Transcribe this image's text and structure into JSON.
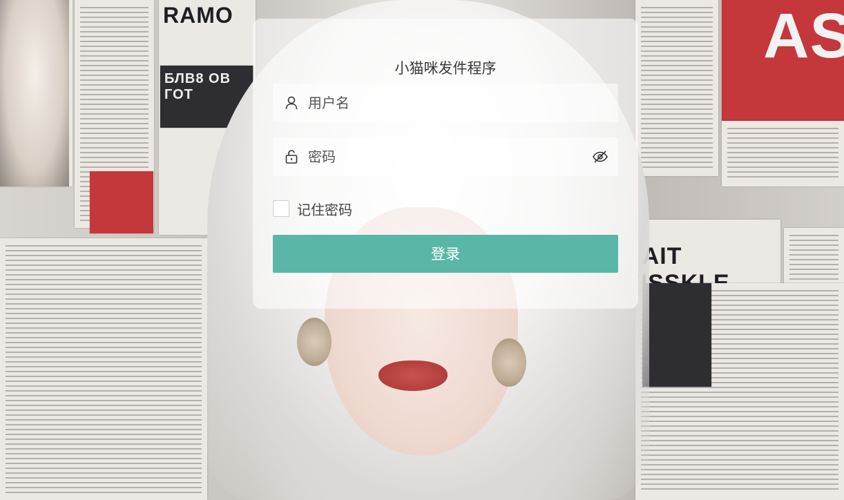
{
  "app": {
    "title": "小猫咪发件程序"
  },
  "form": {
    "username": {
      "placeholder": "用户名",
      "icon": "user-icon"
    },
    "password": {
      "placeholder": "密码",
      "icon": "lock-icon",
      "toggle_icon": "eye-icon"
    },
    "remember_label": "记住密码",
    "remember_checked": false,
    "login_label": "登录"
  },
  "background": {
    "clipping_headlines": [
      "RAMO",
      "БЛВ8 ОВ ГОТ",
      "AS",
      "SAIT FISSKLE"
    ]
  },
  "colors": {
    "accent": "#5ab7a8",
    "card": "rgba(255,255,255,0.58)"
  }
}
